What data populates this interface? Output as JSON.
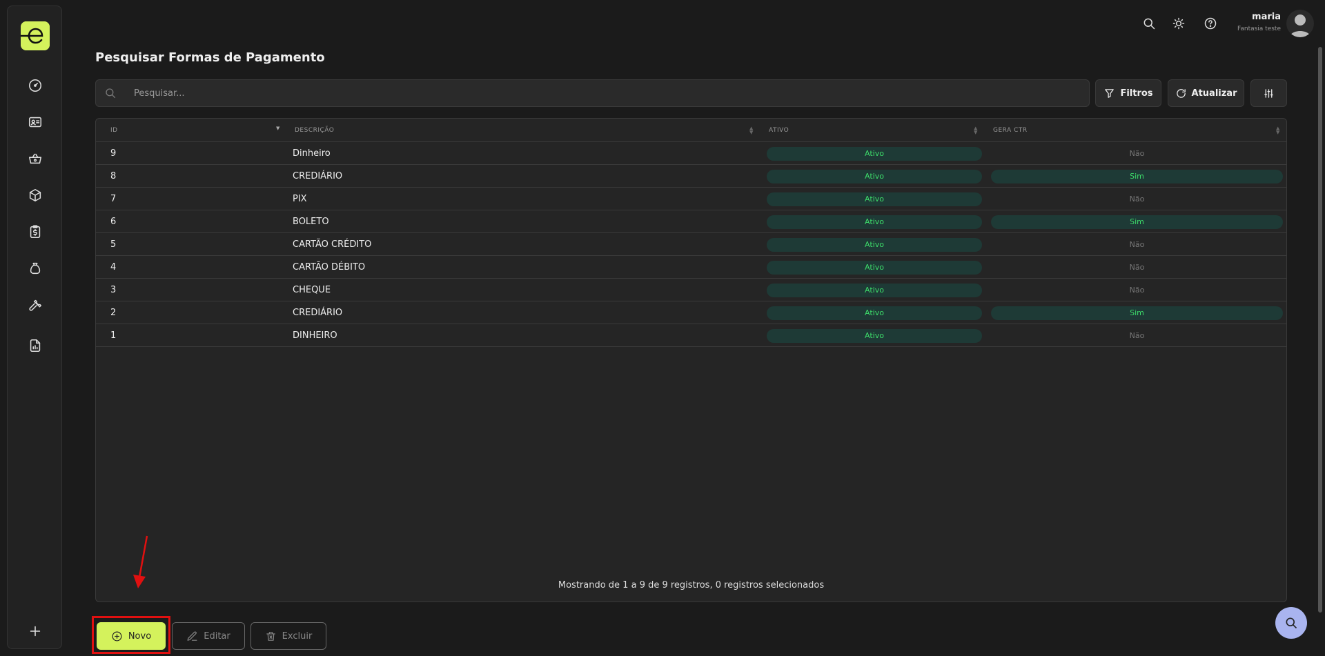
{
  "topbar": {
    "user_name": "maria",
    "company": "Fantasia teste",
    "icons": [
      "search-icon",
      "sun-icon",
      "help-icon"
    ]
  },
  "sidebar": {
    "icons": [
      "dashboard-icon",
      "id-card-icon",
      "basket-icon",
      "box-icon",
      "clipboard-dollar-icon",
      "money-bag-icon",
      "wrench-icon",
      "report-icon",
      "plus-icon"
    ]
  },
  "page": {
    "title": "Pesquisar Formas de Pagamento"
  },
  "search": {
    "placeholder": "Pesquisar..."
  },
  "toolbar": {
    "filtros_label": "Filtros",
    "atualizar_label": "Atualizar"
  },
  "table": {
    "headers": [
      "ID",
      "DESCRIÇÃO",
      "ATIVO",
      "GERA CTR"
    ],
    "rows": [
      {
        "id": "9",
        "descricao": "Dinheiro",
        "ativo": "Ativo",
        "gera_ctr": "Não"
      },
      {
        "id": "8",
        "descricao": "CREDIÁRIO",
        "ativo": "Ativo",
        "gera_ctr": "Sim"
      },
      {
        "id": "7",
        "descricao": "PIX",
        "ativo": "Ativo",
        "gera_ctr": "Não"
      },
      {
        "id": "6",
        "descricao": "BOLETO",
        "ativo": "Ativo",
        "gera_ctr": "Sim"
      },
      {
        "id": "5",
        "descricao": "CARTÃO CRÉDITO",
        "ativo": "Ativo",
        "gera_ctr": "Não"
      },
      {
        "id": "4",
        "descricao": "CARTÃO DÉBITO",
        "ativo": "Ativo",
        "gera_ctr": "Não"
      },
      {
        "id": "3",
        "descricao": "CHEQUE",
        "ativo": "Ativo",
        "gera_ctr": "Não"
      },
      {
        "id": "2",
        "descricao": "CREDIÁRIO",
        "ativo": "Ativo",
        "gera_ctr": "Sim"
      },
      {
        "id": "1",
        "descricao": "DINHEIRO",
        "ativo": "Ativo",
        "gera_ctr": "Não"
      }
    ],
    "footer": "Mostrando de 1 a 9 de 9 registros, 0 registros selecionados"
  },
  "actions": {
    "novo_label": "Novo",
    "editar_label": "Editar",
    "excluir_label": "Excluir"
  },
  "colors": {
    "accent": "#d4f25c",
    "status_green": "#3ddc6a",
    "pill_bg": "#1e3a36",
    "annotation_red": "#e01010"
  }
}
